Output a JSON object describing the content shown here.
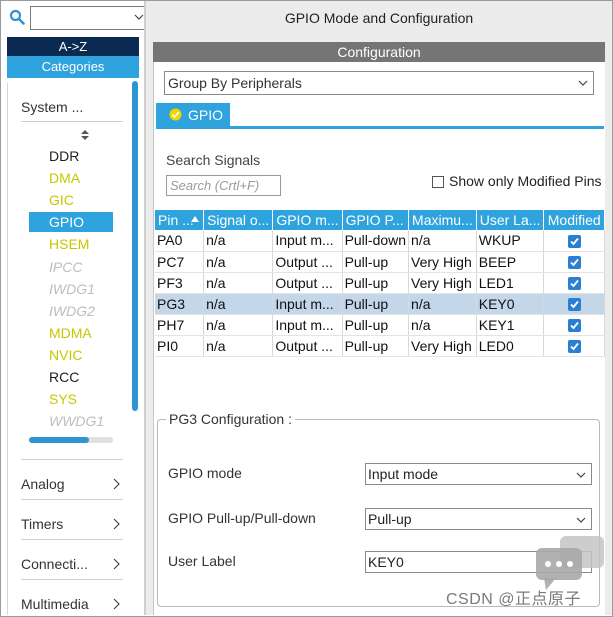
{
  "left": {
    "search_value": "",
    "sort_az": "A->Z",
    "categories_label": "Categories",
    "system_header": "System ...",
    "system_items": [
      {
        "label": "DDR",
        "color": "#222222"
      },
      {
        "label": "DMA",
        "color": "#c7c700"
      },
      {
        "label": "GIC",
        "color": "#c7c700"
      },
      {
        "label": "GPIO",
        "color": "#ffffff"
      },
      {
        "label": "HSEM",
        "color": "#c7c700"
      },
      {
        "label": "IPCC",
        "color": "#bdbdbd"
      },
      {
        "label": "IWDG1",
        "color": "#bdbdbd"
      },
      {
        "label": "IWDG2",
        "color": "#bdbdbd"
      },
      {
        "label": "MDMA",
        "color": "#c7c700"
      },
      {
        "label": "NVIC",
        "color": "#c7c700"
      },
      {
        "label": "RCC",
        "color": "#222222"
      },
      {
        "label": "SYS",
        "color": "#c7c700"
      },
      {
        "label": "WWDG1",
        "color": "#bdbdbd"
      }
    ],
    "categories": [
      {
        "label": "Analog"
      },
      {
        "label": "Timers"
      },
      {
        "label": "Connecti..."
      },
      {
        "label": "Multimedia"
      }
    ]
  },
  "right": {
    "title": "GPIO Mode and Configuration",
    "config_bar": "Configuration",
    "group_by": "Group By Peripherals",
    "tab": "GPIO",
    "search_signals_label": "Search Signals",
    "search_placeholder": "Search (Crtl+F)",
    "show_modified_label": "Show only Modified Pins",
    "table": {
      "headers": [
        "Pin ...",
        "Signal o...",
        "GPIO m...",
        "GPIO P...",
        "Maximu...",
        "User La...",
        "Modified"
      ],
      "rows": [
        [
          "PA0",
          "n/a",
          "Input m...",
          "Pull-down",
          "n/a",
          "WKUP"
        ],
        [
          "PC7",
          "n/a",
          "Output ...",
          "Pull-up",
          "Very High",
          "BEEP"
        ],
        [
          "PF3",
          "n/a",
          "Output ...",
          "Pull-up",
          "Very High",
          "LED1"
        ],
        [
          "PG3",
          "n/a",
          "Input m...",
          "Pull-up",
          "n/a",
          "KEY0"
        ],
        [
          "PH7",
          "n/a",
          "Input m...",
          "Pull-up",
          "n/a",
          "KEY1"
        ],
        [
          "PI0",
          "n/a",
          "Output ...",
          "Pull-up",
          "Very High",
          "LED0"
        ]
      ],
      "modified": [
        true,
        true,
        true,
        true,
        true,
        true
      ],
      "selected_row": 3
    },
    "pin_config": {
      "title": "PG3 Configuration :",
      "gpio_mode_label": "GPIO mode",
      "gpio_mode_value": "Input mode",
      "pull_label": "GPIO Pull-up/Pull-down",
      "pull_value": "Pull-up",
      "user_label_label": "User Label",
      "user_label_value": "KEY0"
    }
  },
  "watermark": "CSDN @正点原子",
  "colors": {
    "accent": "#2ea3dd",
    "nav_dark": "#0b2a52",
    "config_bar": "#757575",
    "selected_row": "#c3d6ea"
  }
}
